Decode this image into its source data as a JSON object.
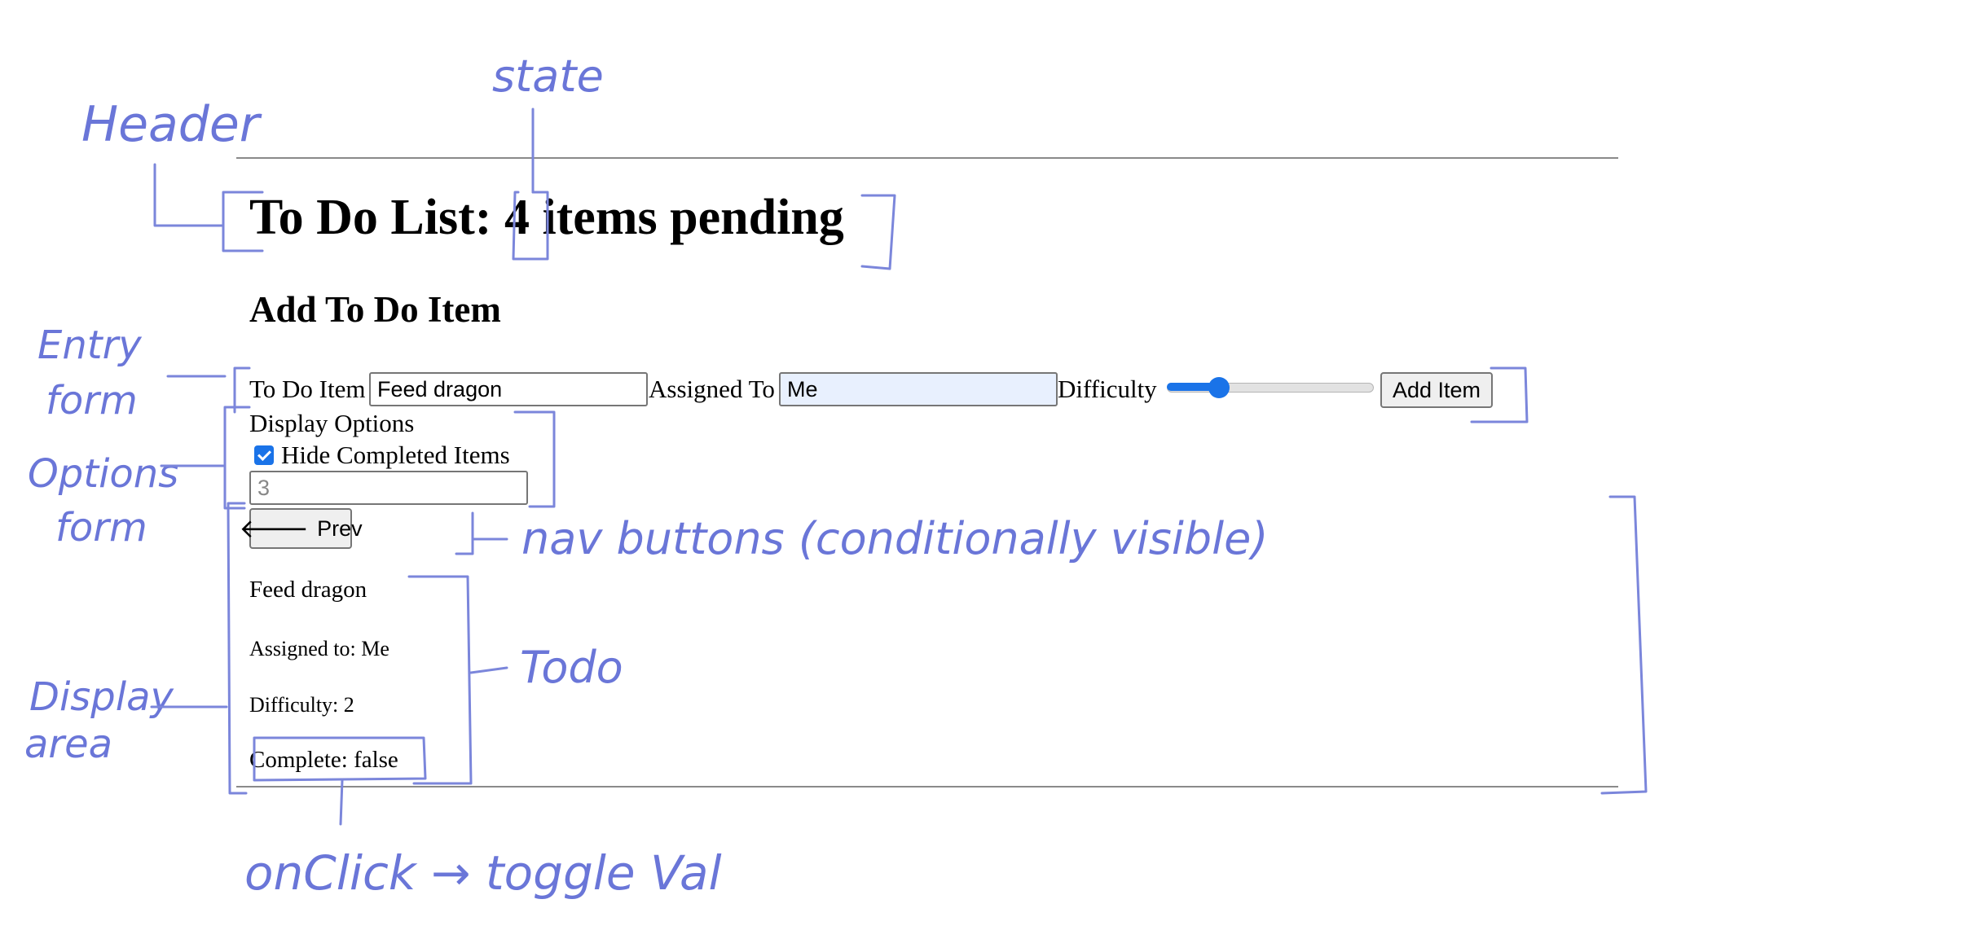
{
  "header": {
    "title_prefix": "To Do List:",
    "pending_count": "4",
    "title_suffix": "items pending"
  },
  "entry_form": {
    "heading": "Add To Do Item",
    "todo_label": "To Do Item",
    "todo_value": "Feed dragon",
    "assigned_label": "Assigned To",
    "assigned_value": "Me",
    "difficulty_label": "Difficulty",
    "difficulty_value": 2,
    "difficulty_min": 1,
    "difficulty_max": 5,
    "add_button_label": "Add Item"
  },
  "options_form": {
    "title": "Display Options",
    "hide_completed_label": "Hide Completed Items",
    "hide_completed_checked": true,
    "count_placeholder": "3"
  },
  "nav": {
    "prev_label": "Prev"
  },
  "todo": {
    "text": "Feed dragon",
    "assignee": "Assigned to: Me",
    "difficulty": "Difficulty: 2",
    "complete": "Complete: false"
  },
  "annotations": {
    "header": "Header",
    "state": "state",
    "entry_form_line1": "Entry",
    "entry_form_line2": "form",
    "options_form_line1": "Options",
    "options_form_line2": "form",
    "nav_buttons": "nav buttons (conditionally visible)",
    "todo": "Todo",
    "display_area_line1": "Display",
    "display_area_line2": "area",
    "onclick": "onClick → toggle Val",
    "color": "#6a76d8"
  }
}
